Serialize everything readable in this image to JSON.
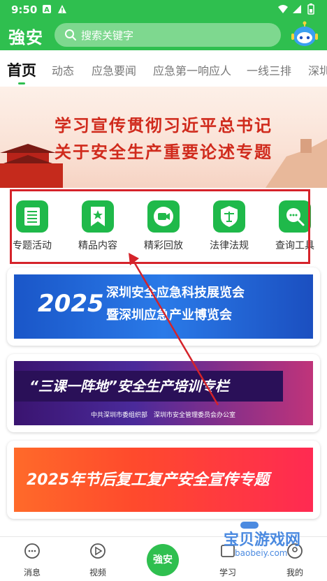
{
  "status": {
    "time": "9:50"
  },
  "header": {
    "logo": "強安",
    "search_placeholder": "搜索关键字"
  },
  "tabs": [
    "首页",
    "动态",
    "应急要闻",
    "应急第一响应人",
    "一线三排",
    "深圳"
  ],
  "banner": {
    "line1": "学习宣传贯彻习近平总书记",
    "line2": "关于安全生产重要论述专题"
  },
  "shortcuts": [
    {
      "label": "专题活动",
      "icon": "list-icon"
    },
    {
      "label": "精品内容",
      "icon": "bookmark-star-icon"
    },
    {
      "label": "精彩回放",
      "icon": "video-icon"
    },
    {
      "label": "法律法规",
      "icon": "scale-shield-icon"
    },
    {
      "label": "查询工具",
      "icon": "search-chat-icon"
    }
  ],
  "cards": [
    {
      "year": "2025",
      "line1": "深圳安全应急科技展览会",
      "line2": "暨深圳应急产业博览会"
    },
    {
      "line1": "“三课一阵地”安全生产培训专栏",
      "line2": "中共深圳市委组织部　深圳市安全管理委员会办公室"
    },
    {
      "line1": "2025年节后复工复产安全宣传专题"
    }
  ],
  "bottom_nav": [
    {
      "label": "消息",
      "icon": "message-icon"
    },
    {
      "label": "视频",
      "icon": "video-play-icon"
    },
    {
      "label": "強安",
      "icon": "center-logo"
    },
    {
      "label": "学习",
      "icon": "study-icon"
    },
    {
      "label": "我的",
      "icon": "user-icon"
    }
  ],
  "watermark": {
    "text": "宝贝游戏网",
    "url": "baobeiy.com"
  },
  "colors": {
    "brand_green": "#2fbf4f",
    "highlight_red": "#d5232a"
  }
}
